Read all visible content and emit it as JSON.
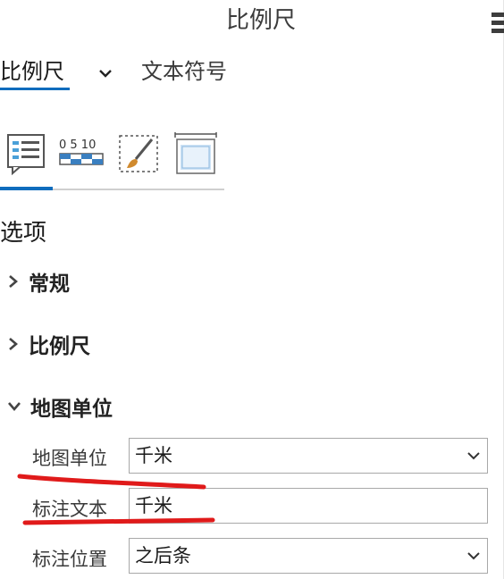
{
  "pane": {
    "title": "比例尺"
  },
  "tabs": [
    {
      "label": "比例尺",
      "active": true
    },
    {
      "label": "文本符号",
      "active": false
    }
  ],
  "icon_tabs": [
    {
      "name": "options-icon",
      "active": true
    },
    {
      "name": "scale-bar-icon",
      "label": "0 5 10",
      "active": false
    },
    {
      "name": "brush-icon",
      "active": false
    },
    {
      "name": "display-icon",
      "active": false
    }
  ],
  "options": {
    "title": "选项",
    "groups": [
      {
        "label": "常规",
        "expanded": false
      },
      {
        "label": "比例尺",
        "expanded": false
      },
      {
        "label": "地图单位",
        "expanded": true
      }
    ],
    "fields": {
      "map_units": {
        "label": "地图单位",
        "value": "千米"
      },
      "label_text": {
        "label": "标注文本",
        "value": "千米"
      },
      "label_position": {
        "label": "标注位置",
        "value": "之后条"
      }
    }
  },
  "colors": {
    "accent": "#0f6cbd",
    "annotation": "#e01a1a"
  }
}
